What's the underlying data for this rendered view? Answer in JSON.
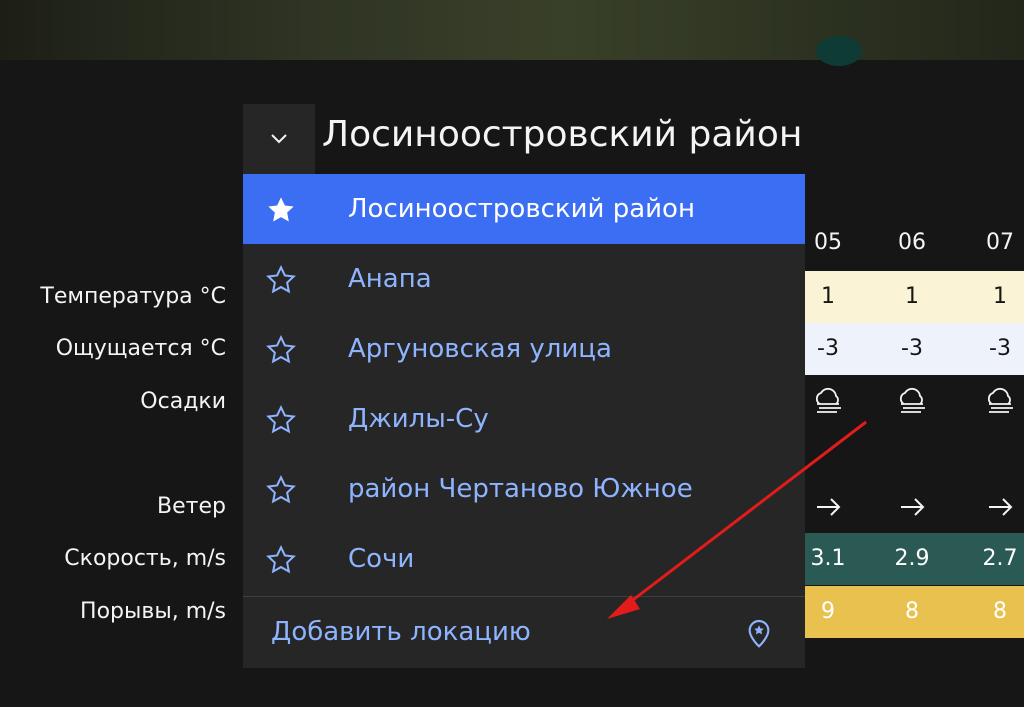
{
  "location": {
    "title": "Лосиноостровский район",
    "dropdown_icon": "chevron-down-icon"
  },
  "row_labels": {
    "temperature": "Температура °C",
    "feels_like": "Ощущается °C",
    "precipitation": "Осадки",
    "wind": "Ветер",
    "speed": "Скорость, m/s",
    "gusts": "Порывы, m/s"
  },
  "forecast": {
    "hours": [
      "05",
      "06",
      "07"
    ],
    "temperature": [
      "1",
      "1",
      "1"
    ],
    "feels_like": [
      "-3",
      "-3",
      "-3"
    ],
    "precipitation_icon": "fog-cloud-icon",
    "wind_icon": "arrow-right-icon",
    "speed": [
      "3.1",
      "2.9",
      "2.7"
    ],
    "gusts": [
      "9",
      "8",
      "8"
    ]
  },
  "dropdown": {
    "items": [
      {
        "label": "Лосиноостровский район",
        "icon": "star-filled-icon",
        "selected": true
      },
      {
        "label": "Анапа",
        "icon": "star-outline-icon",
        "selected": false
      },
      {
        "label": "Аргуновская улица",
        "icon": "star-outline-icon",
        "selected": false
      },
      {
        "label": "Джилы-Су",
        "icon": "star-outline-icon",
        "selected": false
      },
      {
        "label": "район Чертаново Южное",
        "icon": "star-outline-icon",
        "selected": false
      },
      {
        "label": "Сочи",
        "icon": "star-outline-icon",
        "selected": false
      }
    ],
    "add_location": "Добавить локацию",
    "add_location_icon": "map-pin-star-icon"
  },
  "colors": {
    "accent": "#3b6ef2",
    "link": "#8fb4ff",
    "temp_band": "#fbf3d6",
    "feels_band": "#eef3fb",
    "speed_band": "#2b5a55",
    "gusts_band": "#e8c14e",
    "annotation_arrow": "#e21b1b"
  }
}
